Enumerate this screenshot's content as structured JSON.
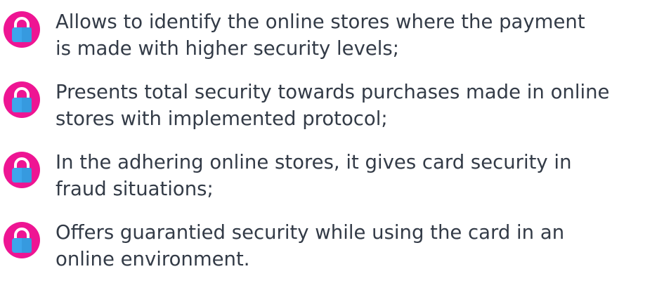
{
  "colors": {
    "badge": "#ee1593",
    "lock_body": "#3ea6ec",
    "lock_body_shade": "#2f8fd6",
    "shackle": "#ffffff",
    "text": "#333b47"
  },
  "items": [
    {
      "icon": "padlock-icon",
      "lines": [
        "Allows to identify the online stores where the payment",
        "is made with higher security levels;"
      ]
    },
    {
      "icon": "padlock-icon",
      "lines": [
        "Presents total security towards purchases made in online",
        "stores with implemented protocol;"
      ]
    },
    {
      "icon": "padlock-icon",
      "lines": [
        "In the adhering  online stores, it gives card security in",
        "fraud situations;"
      ]
    },
    {
      "icon": "padlock-icon",
      "lines": [
        "Offers guarantied security while using the card in an",
        "online environment."
      ]
    }
  ]
}
